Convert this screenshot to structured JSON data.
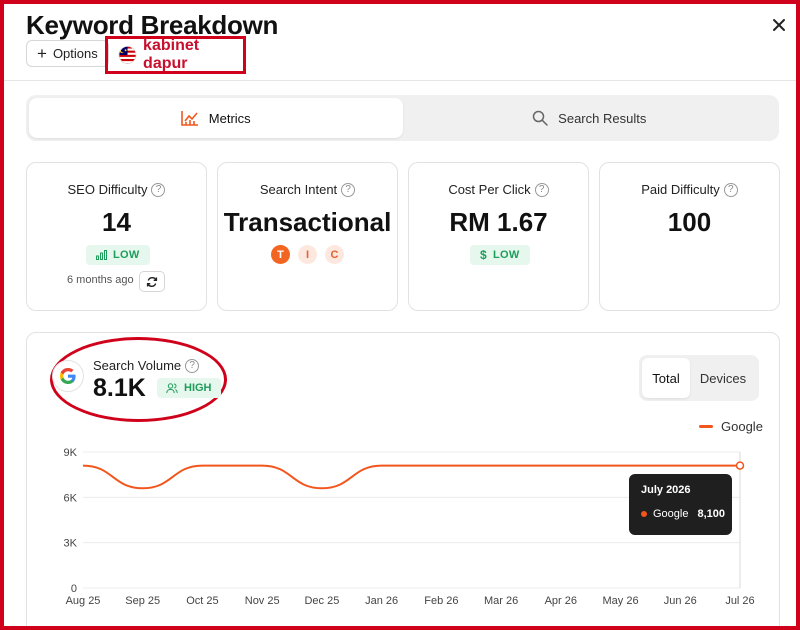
{
  "header": {
    "title": "Keyword Breakdown",
    "options_label": "Options",
    "keyword": "kabinet dapur",
    "flag": "malaysia-flag-icon"
  },
  "tabs": [
    {
      "label": "Metrics",
      "icon": "chart-icon",
      "active": true
    },
    {
      "label": "Search Results",
      "icon": "search-icon",
      "active": false
    }
  ],
  "metrics": {
    "seo_difficulty": {
      "label": "SEO Difficulty",
      "value": "14",
      "badge": "LOW",
      "updated": "6 months ago"
    },
    "search_intent": {
      "label": "Search Intent",
      "value": "Transactional",
      "pills": [
        "T",
        "I",
        "C"
      ]
    },
    "cost_per_click": {
      "label": "Cost Per Click",
      "value": "RM 1.67",
      "badge": "LOW"
    },
    "paid_difficulty": {
      "label": "Paid Difficulty",
      "value": "100"
    }
  },
  "volume": {
    "label": "Search Volume",
    "value": "8.1K",
    "badge": "HIGH",
    "toggle": [
      "Total",
      "Devices"
    ],
    "legend": "Google"
  },
  "tooltip": {
    "title": "July 2026",
    "series": "Google",
    "value": "8,100"
  },
  "colors": {
    "accent": "#f2561d",
    "good": "#1f9d5a",
    "good_bg": "#e6f7ee",
    "border_red": "#d0021b"
  },
  "chart_data": {
    "type": "line",
    "x": [
      "Aug 25",
      "Sep 25",
      "Oct 25",
      "Nov 25",
      "Dec 25",
      "Jan 26",
      "Feb 26",
      "Mar 26",
      "Apr 26",
      "May 26",
      "Jun 26",
      "Jul 26"
    ],
    "series": [
      {
        "name": "Google",
        "values": [
          8100,
          6600,
          8100,
          8100,
          6600,
          8100,
          8100,
          8100,
          8100,
          8100,
          8100,
          8100
        ]
      }
    ],
    "y_ticks": [
      "0",
      "3K",
      "6K",
      "9K"
    ],
    "ylim": [
      0,
      9000
    ],
    "grid": "horizontal",
    "legend": "top-right"
  }
}
